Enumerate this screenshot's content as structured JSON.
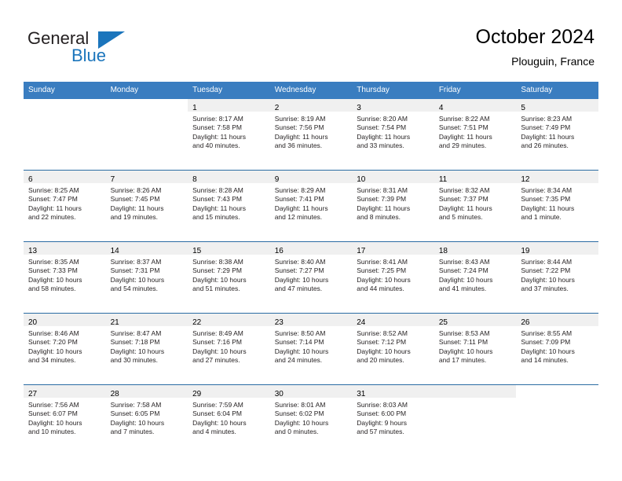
{
  "brand": {
    "name_top": "General",
    "name_bottom": "Blue",
    "triangle_icon": "triangle-icon",
    "color_blue": "#1b75bc",
    "color_dark": "#231f20"
  },
  "header": {
    "title": "October 2024",
    "subtitle": "Plouguin, France"
  },
  "theme": {
    "header_row_bg": "#3a7dc0",
    "row_rule": "#2b6ca3",
    "day_band_bg": "#f0f0f0",
    "text": "#231f20"
  },
  "weekdays": [
    "Sunday",
    "Monday",
    "Tuesday",
    "Wednesday",
    "Thursday",
    "Friday",
    "Saturday"
  ],
  "weeks": [
    [
      {
        "blank": true,
        "day": "",
        "sunrise": "",
        "sunset": "",
        "daylight1": "",
        "daylight2": ""
      },
      {
        "blank": true,
        "day": "",
        "sunrise": "",
        "sunset": "",
        "daylight1": "",
        "daylight2": ""
      },
      {
        "blank": false,
        "day": "1",
        "sunrise": "Sunrise: 8:17 AM",
        "sunset": "Sunset: 7:58 PM",
        "daylight1": "Daylight: 11 hours",
        "daylight2": "and 40 minutes."
      },
      {
        "blank": false,
        "day": "2",
        "sunrise": "Sunrise: 8:19 AM",
        "sunset": "Sunset: 7:56 PM",
        "daylight1": "Daylight: 11 hours",
        "daylight2": "and 36 minutes."
      },
      {
        "blank": false,
        "day": "3",
        "sunrise": "Sunrise: 8:20 AM",
        "sunset": "Sunset: 7:54 PM",
        "daylight1": "Daylight: 11 hours",
        "daylight2": "and 33 minutes."
      },
      {
        "blank": false,
        "day": "4",
        "sunrise": "Sunrise: 8:22 AM",
        "sunset": "Sunset: 7:51 PM",
        "daylight1": "Daylight: 11 hours",
        "daylight2": "and 29 minutes."
      },
      {
        "blank": false,
        "day": "5",
        "sunrise": "Sunrise: 8:23 AM",
        "sunset": "Sunset: 7:49 PM",
        "daylight1": "Daylight: 11 hours",
        "daylight2": "and 26 minutes."
      }
    ],
    [
      {
        "blank": false,
        "day": "6",
        "sunrise": "Sunrise: 8:25 AM",
        "sunset": "Sunset: 7:47 PM",
        "daylight1": "Daylight: 11 hours",
        "daylight2": "and 22 minutes."
      },
      {
        "blank": false,
        "day": "7",
        "sunrise": "Sunrise: 8:26 AM",
        "sunset": "Sunset: 7:45 PM",
        "daylight1": "Daylight: 11 hours",
        "daylight2": "and 19 minutes."
      },
      {
        "blank": false,
        "day": "8",
        "sunrise": "Sunrise: 8:28 AM",
        "sunset": "Sunset: 7:43 PM",
        "daylight1": "Daylight: 11 hours",
        "daylight2": "and 15 minutes."
      },
      {
        "blank": false,
        "day": "9",
        "sunrise": "Sunrise: 8:29 AM",
        "sunset": "Sunset: 7:41 PM",
        "daylight1": "Daylight: 11 hours",
        "daylight2": "and 12 minutes."
      },
      {
        "blank": false,
        "day": "10",
        "sunrise": "Sunrise: 8:31 AM",
        "sunset": "Sunset: 7:39 PM",
        "daylight1": "Daylight: 11 hours",
        "daylight2": "and 8 minutes."
      },
      {
        "blank": false,
        "day": "11",
        "sunrise": "Sunrise: 8:32 AM",
        "sunset": "Sunset: 7:37 PM",
        "daylight1": "Daylight: 11 hours",
        "daylight2": "and 5 minutes."
      },
      {
        "blank": false,
        "day": "12",
        "sunrise": "Sunrise: 8:34 AM",
        "sunset": "Sunset: 7:35 PM",
        "daylight1": "Daylight: 11 hours",
        "daylight2": "and 1 minute."
      }
    ],
    [
      {
        "blank": false,
        "day": "13",
        "sunrise": "Sunrise: 8:35 AM",
        "sunset": "Sunset: 7:33 PM",
        "daylight1": "Daylight: 10 hours",
        "daylight2": "and 58 minutes."
      },
      {
        "blank": false,
        "day": "14",
        "sunrise": "Sunrise: 8:37 AM",
        "sunset": "Sunset: 7:31 PM",
        "daylight1": "Daylight: 10 hours",
        "daylight2": "and 54 minutes."
      },
      {
        "blank": false,
        "day": "15",
        "sunrise": "Sunrise: 8:38 AM",
        "sunset": "Sunset: 7:29 PM",
        "daylight1": "Daylight: 10 hours",
        "daylight2": "and 51 minutes."
      },
      {
        "blank": false,
        "day": "16",
        "sunrise": "Sunrise: 8:40 AM",
        "sunset": "Sunset: 7:27 PM",
        "daylight1": "Daylight: 10 hours",
        "daylight2": "and 47 minutes."
      },
      {
        "blank": false,
        "day": "17",
        "sunrise": "Sunrise: 8:41 AM",
        "sunset": "Sunset: 7:25 PM",
        "daylight1": "Daylight: 10 hours",
        "daylight2": "and 44 minutes."
      },
      {
        "blank": false,
        "day": "18",
        "sunrise": "Sunrise: 8:43 AM",
        "sunset": "Sunset: 7:24 PM",
        "daylight1": "Daylight: 10 hours",
        "daylight2": "and 41 minutes."
      },
      {
        "blank": false,
        "day": "19",
        "sunrise": "Sunrise: 8:44 AM",
        "sunset": "Sunset: 7:22 PM",
        "daylight1": "Daylight: 10 hours",
        "daylight2": "and 37 minutes."
      }
    ],
    [
      {
        "blank": false,
        "day": "20",
        "sunrise": "Sunrise: 8:46 AM",
        "sunset": "Sunset: 7:20 PM",
        "daylight1": "Daylight: 10 hours",
        "daylight2": "and 34 minutes."
      },
      {
        "blank": false,
        "day": "21",
        "sunrise": "Sunrise: 8:47 AM",
        "sunset": "Sunset: 7:18 PM",
        "daylight1": "Daylight: 10 hours",
        "daylight2": "and 30 minutes."
      },
      {
        "blank": false,
        "day": "22",
        "sunrise": "Sunrise: 8:49 AM",
        "sunset": "Sunset: 7:16 PM",
        "daylight1": "Daylight: 10 hours",
        "daylight2": "and 27 minutes."
      },
      {
        "blank": false,
        "day": "23",
        "sunrise": "Sunrise: 8:50 AM",
        "sunset": "Sunset: 7:14 PM",
        "daylight1": "Daylight: 10 hours",
        "daylight2": "and 24 minutes."
      },
      {
        "blank": false,
        "day": "24",
        "sunrise": "Sunrise: 8:52 AM",
        "sunset": "Sunset: 7:12 PM",
        "daylight1": "Daylight: 10 hours",
        "daylight2": "and 20 minutes."
      },
      {
        "blank": false,
        "day": "25",
        "sunrise": "Sunrise: 8:53 AM",
        "sunset": "Sunset: 7:11 PM",
        "daylight1": "Daylight: 10 hours",
        "daylight2": "and 17 minutes."
      },
      {
        "blank": false,
        "day": "26",
        "sunrise": "Sunrise: 8:55 AM",
        "sunset": "Sunset: 7:09 PM",
        "daylight1": "Daylight: 10 hours",
        "daylight2": "and 14 minutes."
      }
    ],
    [
      {
        "blank": false,
        "day": "27",
        "sunrise": "Sunrise: 7:56 AM",
        "sunset": "Sunset: 6:07 PM",
        "daylight1": "Daylight: 10 hours",
        "daylight2": "and 10 minutes."
      },
      {
        "blank": false,
        "day": "28",
        "sunrise": "Sunrise: 7:58 AM",
        "sunset": "Sunset: 6:05 PM",
        "daylight1": "Daylight: 10 hours",
        "daylight2": "and 7 minutes."
      },
      {
        "blank": false,
        "day": "29",
        "sunrise": "Sunrise: 7:59 AM",
        "sunset": "Sunset: 6:04 PM",
        "daylight1": "Daylight: 10 hours",
        "daylight2": "and 4 minutes."
      },
      {
        "blank": false,
        "day": "30",
        "sunrise": "Sunrise: 8:01 AM",
        "sunset": "Sunset: 6:02 PM",
        "daylight1": "Daylight: 10 hours",
        "daylight2": "and 0 minutes."
      },
      {
        "blank": false,
        "day": "31",
        "sunrise": "Sunrise: 8:03 AM",
        "sunset": "Sunset: 6:00 PM",
        "daylight1": "Daylight: 9 hours",
        "daylight2": "and 57 minutes."
      },
      {
        "blank": false,
        "day": "",
        "sunrise": "",
        "sunset": "",
        "daylight1": "",
        "daylight2": ""
      },
      {
        "blank": true,
        "day": "",
        "sunrise": "",
        "sunset": "",
        "daylight1": "",
        "daylight2": ""
      }
    ]
  ]
}
